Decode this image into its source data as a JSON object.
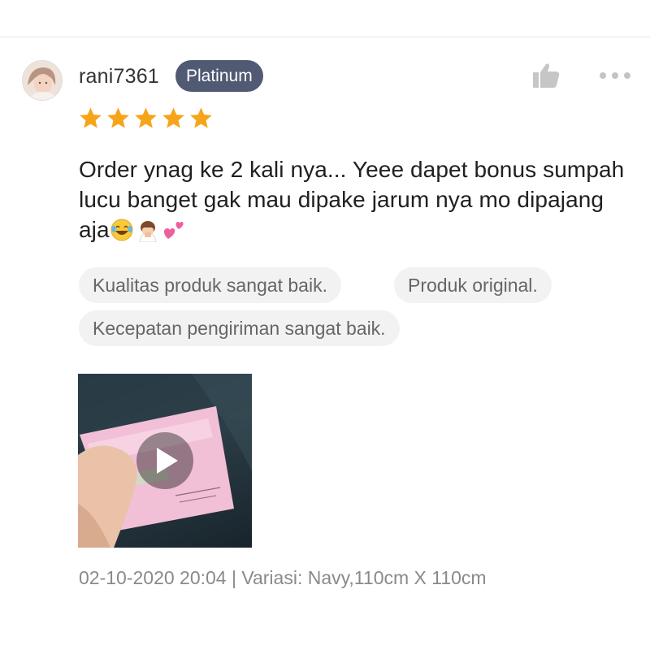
{
  "reviewer": {
    "username": "rani7361",
    "tier_badge": "Platinum"
  },
  "rating": {
    "stars": 5,
    "max": 5,
    "star_color": "#f6a51a"
  },
  "review": {
    "text": "Order ynag ke 2 kali nya... Yeee dapet bonus sumpah lucu banget gak mau dipake jarum nya mo dipajang aja",
    "emojis": [
      "rolling-laughing-face-emoji",
      "person-bowing-emoji",
      "two-hearts-emoji"
    ]
  },
  "tags": [
    "Kualitas produk sangat baik.",
    "Produk original.",
    "Kecepatan pengiriman sangat baik."
  ],
  "media": {
    "type": "video",
    "icon": "play-icon"
  },
  "meta": {
    "text": "02-10-2020 20:04 | Variasi: Navy,110cm X 110cm"
  },
  "icons": {
    "like": "thumbs-up-icon",
    "more": "more-options-icon"
  },
  "colors": {
    "badge_bg": "#505a73",
    "chip_bg": "#f2f2f2",
    "meta_text": "#8a8a8a"
  }
}
